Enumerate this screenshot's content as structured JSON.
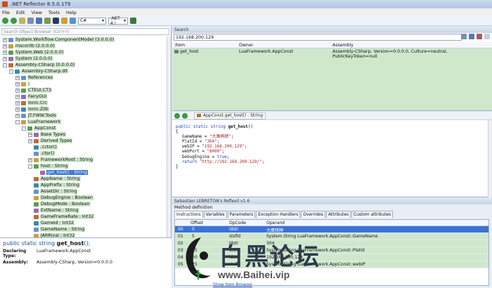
{
  "window": {
    "title": ".NET Reflector 8.5.0.179"
  },
  "menu": [
    "File",
    "Edit",
    "View",
    "Tools",
    "Help"
  ],
  "toolbar": {
    "language": "C#",
    "framework": ".NET 4.!"
  },
  "left": {
    "search_placeholder": "Search Object Browser (Ctrl+F)",
    "tree": [
      {
        "label": "System.Workflow.ComponentModel (3.0.0.0)",
        "indent": 0,
        "expander": "+"
      },
      {
        "label": "mscorlib (2.0.0.0)",
        "indent": 0,
        "expander": "+"
      },
      {
        "label": "System.Web (2.0.0.0)",
        "indent": 0,
        "expander": "+"
      },
      {
        "label": "System (2.0.0.0)",
        "indent": 0,
        "expander": "+"
      },
      {
        "label": "Assembly-CSharp (0.0.0.0)",
        "indent": 0,
        "expander": "-"
      },
      {
        "label": "Assembly-CSharp.dll",
        "indent": 1,
        "expander": "-"
      },
      {
        "label": "References",
        "indent": 2,
        "expander": "+"
      },
      {
        "label": "-",
        "indent": 2,
        "expander": "+"
      },
      {
        "label": "CTEUI.CT3",
        "indent": 2,
        "expander": "+"
      },
      {
        "label": "FairyGUI",
        "indent": 2,
        "expander": "+"
      },
      {
        "label": "Ionic.Crc",
        "indent": 2,
        "expander": "+"
      },
      {
        "label": "Ionic.Zlib",
        "indent": 2,
        "expander": "+"
      },
      {
        "label": "JT.FWW.Tools",
        "indent": 2,
        "expander": "+"
      },
      {
        "label": "LuaFramework",
        "indent": 2,
        "expander": "-"
      },
      {
        "label": "AppConst",
        "indent": 3,
        "expander": "-"
      },
      {
        "label": "Base Types",
        "indent": 4,
        "expander": "+"
      },
      {
        "label": "Derived Types",
        "indent": 4,
        "expander": "+"
      },
      {
        "label": ".cctor()",
        "indent": 4,
        "expander": ""
      },
      {
        "label": ".ctor()",
        "indent": 4,
        "expander": ""
      },
      {
        "label": "FrameworkRoot : String",
        "indent": 4,
        "expander": "+"
      },
      {
        "label": "host : String",
        "indent": 4,
        "expander": "-"
      },
      {
        "label": "get_host() : String",
        "indent": 5,
        "expander": "",
        "selected": true
      },
      {
        "label": "AppName : String",
        "indent": 4,
        "expander": ""
      },
      {
        "label": "AppPrefix : String",
        "indent": 4,
        "expander": ""
      },
      {
        "label": "AssetDir : String",
        "indent": 4,
        "expander": ""
      },
      {
        "label": "DebugEngine : Boolean",
        "indent": 4,
        "expander": ""
      },
      {
        "label": "DebugMode : Boolean",
        "indent": 4,
        "expander": ""
      },
      {
        "label": "ExtName : String",
        "indent": 4,
        "expander": ""
      },
      {
        "label": "GameFrameRate : Int32",
        "indent": 4,
        "expander": ""
      },
      {
        "label": "GameId : Int32",
        "indent": 4,
        "expander": ""
      },
      {
        "label": "GameName : String",
        "indent": 4,
        "expander": ""
      },
      {
        "label": "JARRival : Int32",
        "indent": 4,
        "expander": ""
      }
    ],
    "info": {
      "sig_prefix": "public static string",
      "sig_name": "get_host",
      "sig_suffix": "();",
      "declaring_type_label": "Declaring Type:",
      "declaring_type": "LuaFramework.AppConst",
      "assembly_label": "Assembly:",
      "assembly": "Assembly-CSharp, Version=0.0.0.0"
    }
  },
  "search": {
    "pane_title": "Search",
    "query": "192.168.200.129",
    "columns": [
      "Item",
      "Owner",
      "Assembly"
    ],
    "rows": [
      {
        "item": "get_host",
        "owner": "LuaFramework.AppConst",
        "assembly": "Assembly-CSharp, Version=0.0.0.0, Culture=neutral, PublicKeyToken=null"
      }
    ]
  },
  "code": {
    "tab_label": "AppConst.get_host() : String",
    "lines": [
      {
        "parts": [
          {
            "t": "public static string ",
            "c": "kw"
          },
          {
            "t": "get_host",
            "c": "b"
          },
          {
            "t": "()",
            "c": ""
          }
        ],
        "indent": 0
      },
      {
        "parts": [
          {
            "t": "{",
            "c": ""
          }
        ],
        "indent": 0
      },
      {
        "parts": [
          {
            "t": "GameName = ",
            "c": ""
          },
          {
            "t": "\"大鹰棋牌\"",
            "c": "str"
          },
          {
            "t": ";",
            "c": ""
          }
        ],
        "indent": 1
      },
      {
        "parts": [
          {
            "t": "PlatId = ",
            "c": ""
          },
          {
            "t": "\"304\"",
            "c": "str"
          },
          {
            "t": ";",
            "c": ""
          }
        ],
        "indent": 1
      },
      {
        "parts": [
          {
            "t": "webIP = ",
            "c": ""
          },
          {
            "t": "\"192.168.200.129\"",
            "c": "str"
          },
          {
            "t": ";",
            "c": ""
          }
        ],
        "indent": 1
      },
      {
        "parts": [
          {
            "t": "webPort = ",
            "c": ""
          },
          {
            "t": "\"8000\"",
            "c": "str"
          },
          {
            "t": ";",
            "c": ""
          }
        ],
        "indent": 1
      },
      {
        "parts": [
          {
            "t": "DebugEngine = ",
            "c": ""
          },
          {
            "t": "true",
            "c": "kw"
          },
          {
            "t": ";",
            "c": ""
          }
        ],
        "indent": 1
      },
      {
        "parts": [
          {
            "t": "return ",
            "c": "kw"
          },
          {
            "t": "\"http://192.168.200.129/\"",
            "c": "str"
          },
          {
            "t": ";",
            "c": ""
          }
        ],
        "indent": 1
      },
      {
        "parts": [
          {
            "t": "}",
            "c": ""
          }
        ],
        "indent": 0
      }
    ]
  },
  "reflexil": {
    "title": "Sebastien LEBRETON's Reflexil v1.6",
    "method_definition": "Method definition",
    "tabs": [
      "Instructions",
      "Variables",
      "Parameters",
      "Exception Handlers",
      "Overrides",
      "Attributes",
      "Custom attributes"
    ],
    "columns": [
      "",
      "Offset",
      "OpCode",
      "Operand"
    ],
    "rows": [
      {
        "idx": "00",
        "offset": "0",
        "opcode": "ldstr",
        "operand": "大鹰棋牌",
        "selected": true
      },
      {
        "idx": "01",
        "offset": "5",
        "opcode": "stsfld",
        "operand": "System.String LuaFramework.AppConst::GameName"
      },
      {
        "idx": "02",
        "offset": "10",
        "opcode": "ldstr",
        "operand": "304"
      },
      {
        "idx": "03",
        "offset": "15",
        "opcode": "stsfld",
        "operand": "System.String LuaFramework.AppConst::PlatId"
      },
      {
        "idx": "04",
        "offset": "20",
        "opcode": "ldstr",
        "operand": "192.168.200.129"
      },
      {
        "idx": "05",
        "offset": "25",
        "opcode": "stsfld",
        "operand": "System.String LuaFramework.AppConst::webIP"
      }
    ],
    "show_next": "Show Item Browser"
  },
  "watermark": {
    "cn": "白黑论坛",
    "url": "www.Baihei.vip"
  },
  "colors": {
    "accent": "#3a73d6",
    "highlight": "#cfe8cc",
    "keyword": "#1a3fc4",
    "string": "#b01f1f"
  }
}
